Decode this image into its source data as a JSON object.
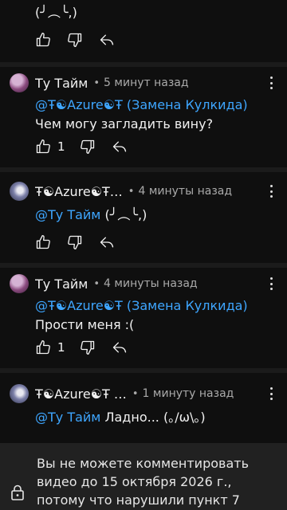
{
  "comments": [
    {
      "author": "",
      "time": "",
      "text": "(╯︵╰,)",
      "likes": ""
    },
    {
      "author": "Ту Тайм",
      "time": "5 минут назад",
      "mention": "@Ŧ☯Azure☯Ŧ (Замена Кулкида)",
      "text": "Чем могу загладить вину?",
      "likes": "1"
    },
    {
      "author": "Ŧ☯Azure☯Ŧ…",
      "time": "4 минуты назад",
      "mention": "@Ту Тайм",
      "text": "(╯︵╰,)",
      "likes": ""
    },
    {
      "author": "Ту Тайм",
      "time": "4 минуты назад",
      "mention": "@Ŧ☯Azure☯Ŧ (Замена Кулкида)",
      "text": "Прости меня :(",
      "likes": "1"
    },
    {
      "author": "Ŧ☯Azure☯Ŧ …",
      "time": "1 минуту назад",
      "mention": "@Ту Тайм",
      "text": "Ладно... (｡/ω\\｡)",
      "likes": ""
    }
  ],
  "restriction": {
    "text": "Вы не можете комментировать видео до 15 октября 2026 г., потому что нарушили пункт 7",
    "icon": "lock-icon"
  },
  "icons": {
    "like": "thumb-up-icon",
    "dislike": "thumb-down-icon",
    "reply": "reply-arrow-icon",
    "menu": "more-vert-icon"
  }
}
